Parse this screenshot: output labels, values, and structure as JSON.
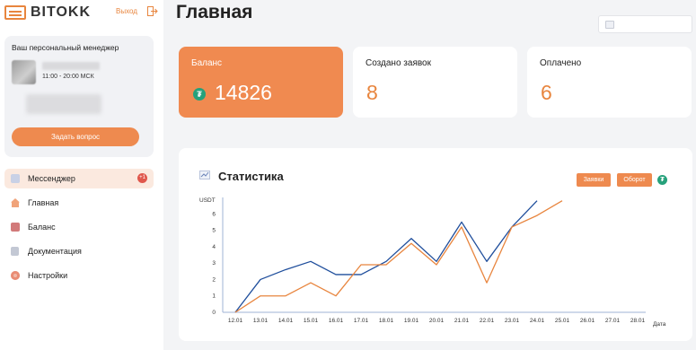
{
  "app": {
    "logo_text": "BITOKK",
    "logout_label": "Выход"
  },
  "manager": {
    "title": "Ваш персональный менеджер",
    "hours": "11:00 - 20:00 МСК",
    "ask_button": "Задать вопрос"
  },
  "nav": [
    {
      "label": "Мессенджер",
      "icon": "messenger-icon",
      "badge": "+1",
      "active": true
    },
    {
      "label": "Главная",
      "icon": "home-icon"
    },
    {
      "label": "Баланс",
      "icon": "wallet-icon"
    },
    {
      "label": "Документация",
      "icon": "document-icon"
    },
    {
      "label": "Настройки",
      "icon": "gear-icon"
    }
  ],
  "page": {
    "title": "Главная"
  },
  "cards": [
    {
      "label": "Баланс",
      "value": "14826",
      "currency_icon": "tether-icon"
    },
    {
      "label": "Создано заявок",
      "value": "8"
    },
    {
      "label": "Оплачено",
      "value": "6"
    }
  ],
  "stats": {
    "title": "Статистика",
    "legend": {
      "requests": "Заявки",
      "turnover": "Оборот"
    }
  },
  "colors": {
    "accent": "#ee8a4f",
    "series_blue": "#1f4e9c",
    "series_orange": "#e8853e",
    "tether": "#26a17b"
  },
  "chart_data": {
    "type": "line",
    "ylabel": "USDT",
    "xlabel": "Дата",
    "ylim": [
      0,
      7
    ],
    "yticks": [
      0,
      1,
      2,
      3,
      4,
      5,
      6
    ],
    "categories": [
      "12.01",
      "13.01",
      "14.01",
      "15.01",
      "16.01",
      "17.01",
      "18.01",
      "19.01",
      "20.01",
      "21.01",
      "22.01",
      "23.01",
      "24.01",
      "25.01",
      "26.01",
      "27.01",
      "28.01"
    ],
    "series": [
      {
        "color": "#1f4e9c",
        "values": [
          0,
          2,
          2.6,
          3.1,
          2.3,
          2.3,
          3.1,
          4.5,
          3.1,
          5.5,
          3.1,
          5.2,
          6.8
        ]
      },
      {
        "color": "#e8853e",
        "values": [
          0,
          1,
          1,
          1.8,
          1,
          2.9,
          2.9,
          4.2,
          2.9,
          5.2,
          1.8,
          5.2,
          5.9,
          6.8
        ]
      }
    ]
  }
}
